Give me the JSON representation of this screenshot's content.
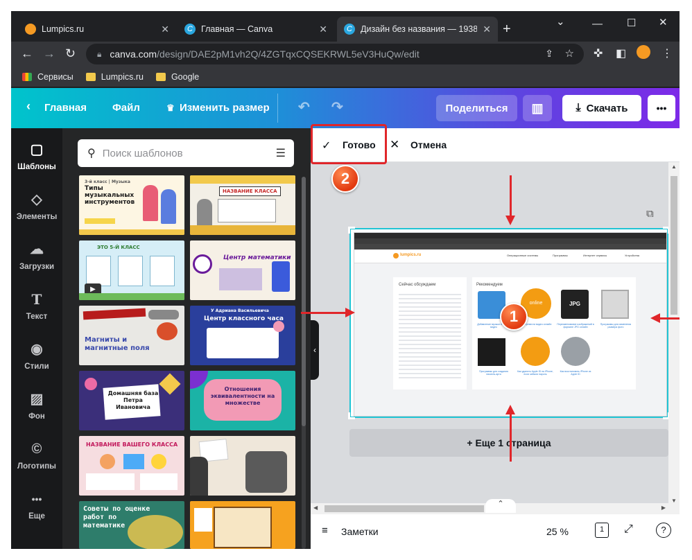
{
  "browser": {
    "tabs": [
      {
        "title": "Lumpics.ru",
        "favicon_color": "#f59a23"
      },
      {
        "title": "Главная — Canva",
        "favicon_color": "#2aa7e0"
      },
      {
        "title": "Дизайн без названия — 1938",
        "favicon_color": "#2aa7e0"
      }
    ],
    "new_tab_glyph": "+",
    "url_domain": "canva.com",
    "url_path": "/design/DAE2pM1vh2Q/4ZGTqxCQSEKRWL5eV3HuQw/edit",
    "bookmarks": [
      {
        "label": "Сервисы",
        "icon": "apps-icon"
      },
      {
        "label": "Lumpics.ru",
        "icon": "folder-icon"
      },
      {
        "label": "Google",
        "icon": "folder-icon"
      }
    ]
  },
  "canva_header": {
    "home": "Главная",
    "file": "Файл",
    "resize": "Изменить размер",
    "share": "Поделиться",
    "download": "Скачать",
    "more": "•••"
  },
  "rail": [
    {
      "label": "Шаблоны",
      "icon": "templates-icon",
      "glyph": "▢",
      "active": true
    },
    {
      "label": "Элементы",
      "icon": "elements-icon",
      "glyph": "◇",
      "active": false
    },
    {
      "label": "Загрузки",
      "icon": "upload-icon",
      "glyph": "☁",
      "active": false
    },
    {
      "label": "Текст",
      "icon": "text-icon",
      "glyph": "T",
      "active": false
    },
    {
      "label": "Стили",
      "icon": "palette-icon",
      "glyph": "◉",
      "active": false
    },
    {
      "label": "Фон",
      "icon": "background-icon",
      "glyph": "▨",
      "active": false
    },
    {
      "label": "Логотипы",
      "icon": "logo-icon",
      "glyph": "©",
      "active": false
    },
    {
      "label": "Еще",
      "icon": "more-icon",
      "glyph": "•••",
      "active": false
    }
  ],
  "panel": {
    "search_placeholder": "Поиск шаблонов",
    "templates": [
      {
        "title": "Типы музыкальных инструментов",
        "subtitle": "3-й класс | Музыка",
        "bg": "#fdf6e3",
        "fg": "#1b1b1b"
      },
      {
        "title": "НАЗВАНИЕ КЛАССА",
        "subtitle": "",
        "bg": "#f3efe6",
        "fg": "#c62828"
      },
      {
        "title": "ЭТО 5-Й КЛАСС",
        "subtitle": "",
        "bg": "#d6eef7",
        "fg": "#2e7d32"
      },
      {
        "title": "Центр математики",
        "subtitle": "",
        "bg": "#f6f0e6",
        "fg": "#6a1b9a"
      },
      {
        "title": "Магниты и магнитные поля",
        "subtitle": "",
        "bg": "#e9e8e4",
        "fg": "#3949ab"
      },
      {
        "title": "Центр классного часа",
        "subtitle": "У Адриана Васильевича",
        "bg": "#2a3f9c",
        "fg": "#ffffff"
      },
      {
        "title": "Домашняя база Петра Ивановича",
        "subtitle": "",
        "bg": "#3b2f7a",
        "fg": "#ffffff"
      },
      {
        "title": "Отношения эквивалентности на множестве",
        "subtitle": "",
        "bg": "#1bb3a6",
        "fg": "#3b1f6e"
      },
      {
        "title": "НАЗВАНИЕ ВАШЕГО КЛАССА",
        "subtitle": "",
        "bg": "#f6dde0",
        "fg": "#c2185b"
      },
      {
        "title": "",
        "subtitle": "",
        "bg": "#efe7da",
        "fg": "#333333"
      },
      {
        "title": "Советы по оценке работ по математике",
        "subtitle": "",
        "bg": "#2e7d6b",
        "fg": "#ffffff"
      },
      {
        "title": "",
        "subtitle": "",
        "bg": "#f6a21f",
        "fg": "#5b3a10"
      }
    ]
  },
  "editor": {
    "done": "Готово",
    "cancel": "Отмена",
    "more_pages": "+ Еще 1 страница",
    "notes": "Заметки",
    "zoom": "25 %",
    "page_count": "1",
    "help": "?"
  },
  "embedded_screenshot": {
    "site_name": "lumpics.ru",
    "nav": [
      "Операционные системы",
      "Программы",
      "Интернет сервисы",
      "Устройства"
    ],
    "discussed_title": "Сейчас обсуждаем",
    "recommend_title": "Рекомендуем",
    "cards": [
      "Добавление музыки и фото в видео",
      "Как перевести видео онлайн",
      "Переименование изображений в формате JPG онлайн",
      "Программы для изменения размера фото",
      "Программы для создания пиксель-арта",
      "Как удалить Apple ID на iPhone, если забыли пароль",
      "Как восстановить iPhone из Apple ID"
    ]
  },
  "annotations": {
    "badge_1": "1",
    "badge_2": "2",
    "color": "#e0262a"
  }
}
